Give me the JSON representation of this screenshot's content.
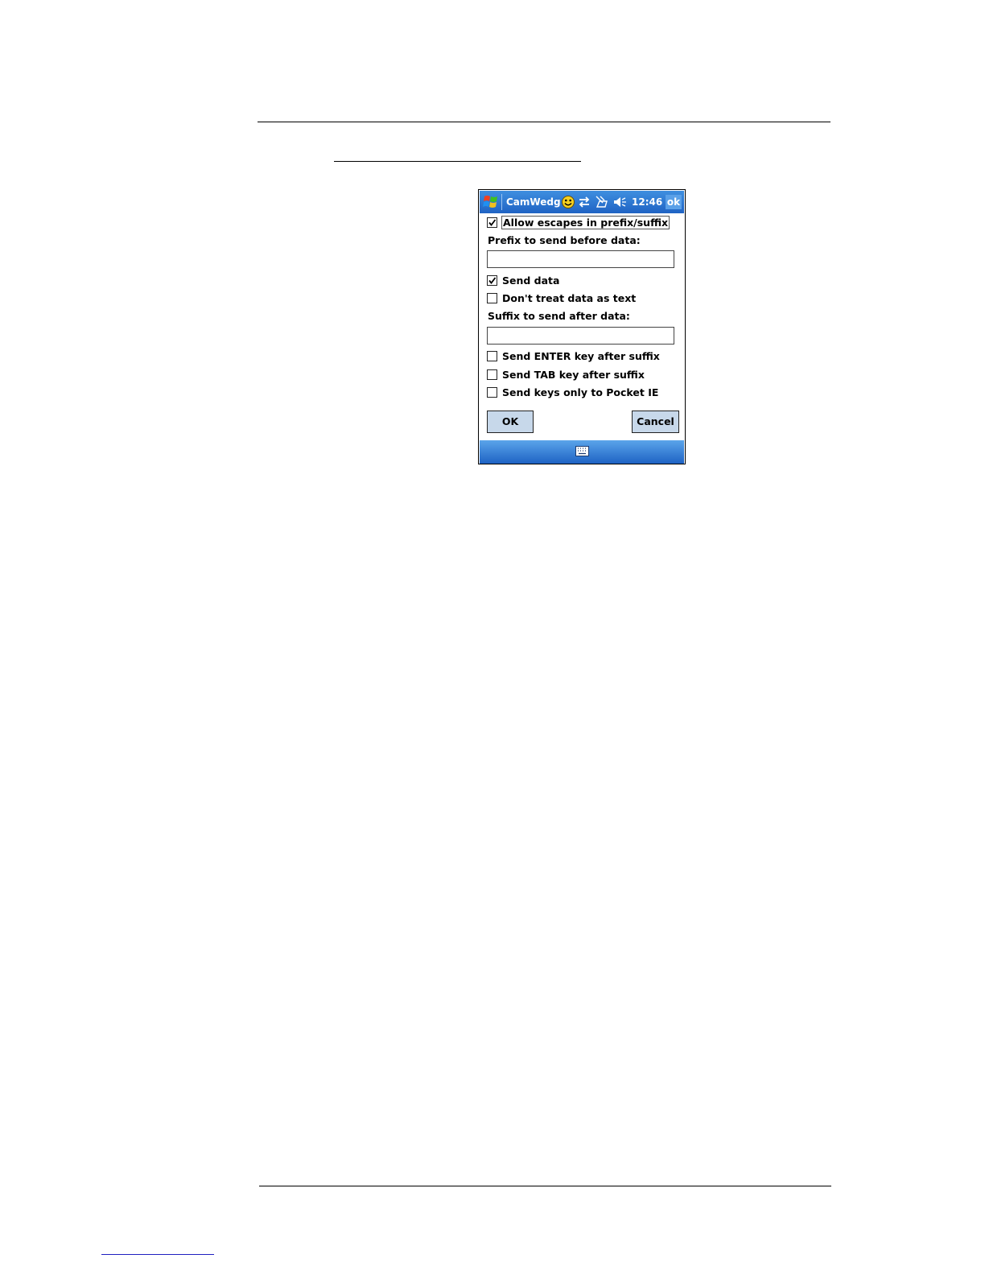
{
  "window": {
    "app_title": "CamWedg",
    "clock": "12:46",
    "ok_label": "ok",
    "icons": [
      "windows-start-icon",
      "smiley-icon",
      "connectivity-icon",
      "phone-off-icon",
      "speaker-mute-icon",
      "keyboard-icon"
    ]
  },
  "form": {
    "allow_escapes": {
      "label": "Allow escapes in prefix/suffix",
      "checked": true
    },
    "prefix_label": "Prefix to send before data:",
    "prefix_value": "",
    "send_data": {
      "label": "Send data",
      "checked": true
    },
    "dont_treat": {
      "label": "Don't treat data as text",
      "checked": false
    },
    "suffix_label": "Suffix to send after data:",
    "suffix_value": "",
    "send_enter": {
      "label": "Send ENTER key after suffix",
      "checked": false
    },
    "send_tab": {
      "label": "Send TAB key after suffix",
      "checked": false
    },
    "pocket_ie": {
      "label": "Send keys only to Pocket IE",
      "checked": false
    }
  },
  "buttons": {
    "ok": "OK",
    "cancel": "Cancel"
  }
}
